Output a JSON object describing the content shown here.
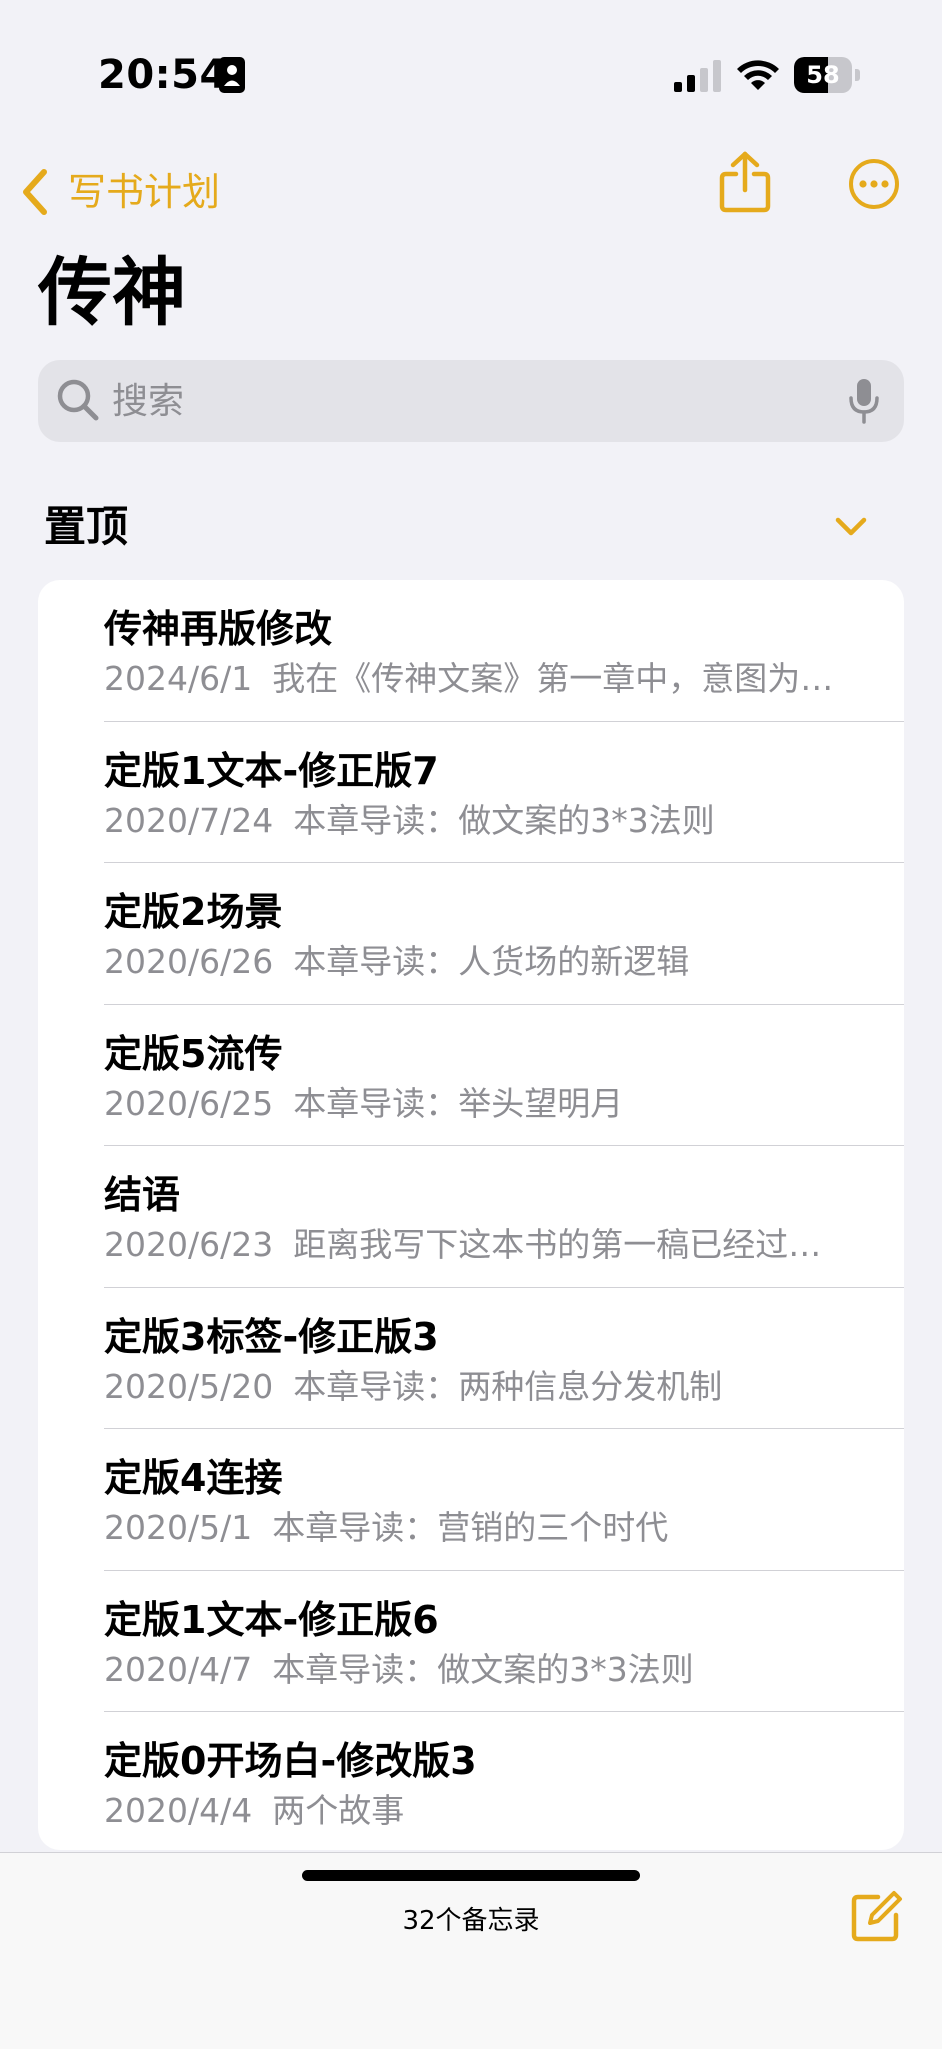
{
  "status_bar": {
    "time": "20:54",
    "battery_level": "58",
    "battery_fraction": 0.58
  },
  "nav": {
    "back_label": "写书计划"
  },
  "page": {
    "title": "传神"
  },
  "search": {
    "placeholder": "搜索"
  },
  "section": {
    "title": "置顶"
  },
  "notes": [
    {
      "title": "传神再版修改",
      "date": "2024/6/1",
      "preview": "我在《传神文案》第一章中，意图为…"
    },
    {
      "title": "定版1文本-修正版7",
      "date": "2020/7/24",
      "preview": "本章导读：做文案的3*3法则"
    },
    {
      "title": "定版2场景",
      "date": "2020/6/26",
      "preview": "本章导读：人货场的新逻辑"
    },
    {
      "title": "定版5流传",
      "date": "2020/6/25",
      "preview": "本章导读：举头望明月"
    },
    {
      "title": "结语",
      "date": "2020/6/23",
      "preview": "距离我写下这本书的第一稿已经过…"
    },
    {
      "title": "定版3标签-修正版3",
      "date": "2020/5/20",
      "preview": "本章导读：两种信息分发机制"
    },
    {
      "title": "定版4连接",
      "date": "2020/5/1",
      "preview": "本章导读：营销的三个时代"
    },
    {
      "title": "定版1文本-修正版6",
      "date": "2020/4/7",
      "preview": "本章导读：做文案的3*3法则"
    },
    {
      "title": "定版0开场白-修改版3",
      "date": "2020/4/4",
      "preview": "两个故事"
    }
  ],
  "toolbar": {
    "note_count": "32个备忘录"
  },
  "colors": {
    "accent": "#e5aa1c",
    "background": "#f2f2f7",
    "secondary_text": "#8e8e93"
  },
  "icons": {
    "back": "chevron-left-icon",
    "share": "share-icon",
    "more": "ellipsis-circle-icon",
    "search": "magnifier-icon",
    "mic": "mic-icon",
    "section_toggle": "chevron-down-icon",
    "compose": "compose-icon"
  }
}
